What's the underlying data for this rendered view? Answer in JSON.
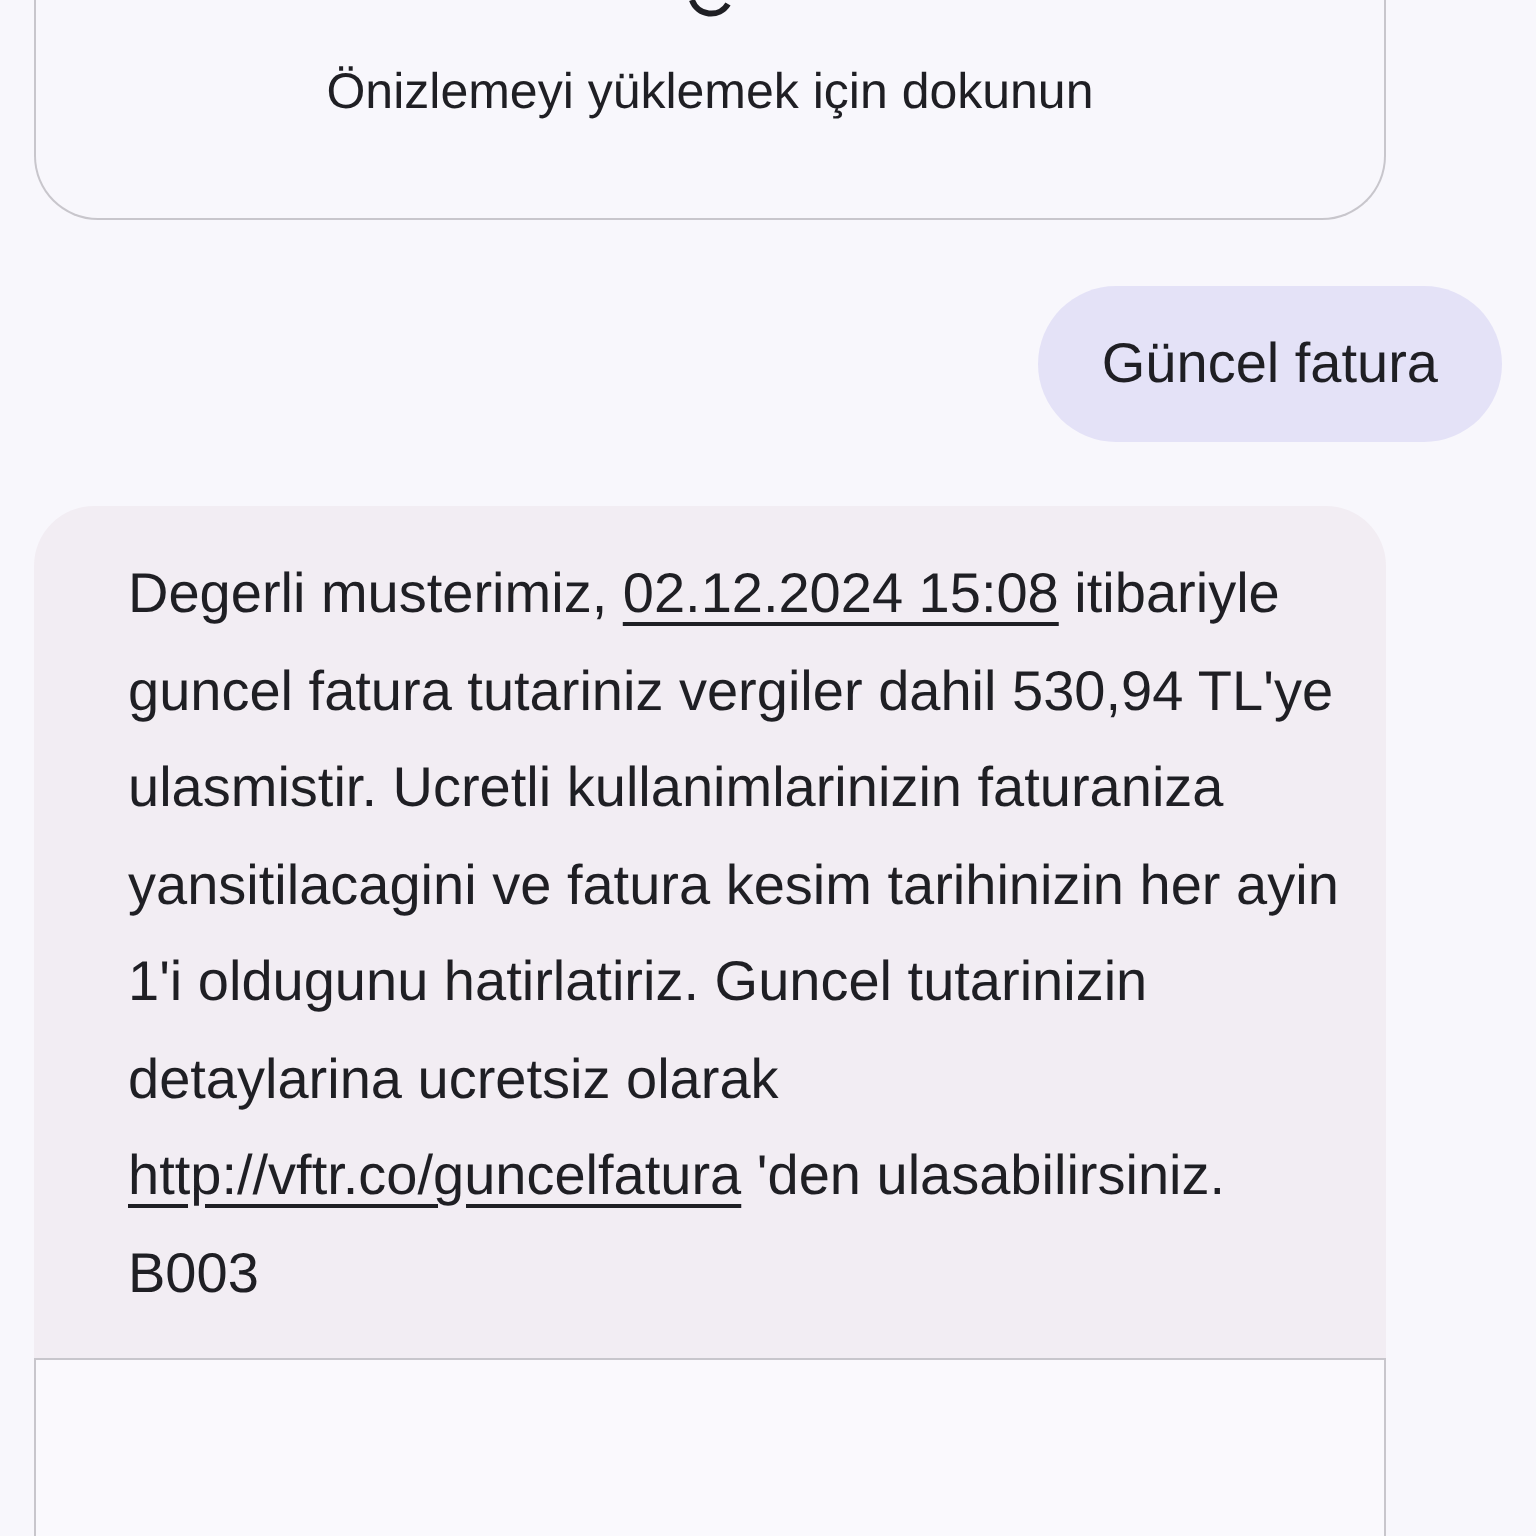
{
  "preview_card": {
    "caption": "Önizlemeyi yüklemek için dokunun"
  },
  "sent_message": {
    "text": "Güncel fatura"
  },
  "received_message": {
    "parts": [
      {
        "kind": "text",
        "text": "Degerli musterimiz, "
      },
      {
        "kind": "link",
        "text": "02.12.2024 15:08"
      },
      {
        "kind": "text",
        "text": " itibariyle guncel fatura tutariniz vergiler dahil 530,94 TL'ye ulasmistir. Ucretli kullanimlarinizin faturaniza yansitilacagini ve fatura kesim tarihinizin her ayin 1'i oldugunu hatirlatiriz. Guncel tutarinizin detaylarina ucretsiz olarak "
      },
      {
        "kind": "link",
        "text": "http://vftr.co/guncelfatura"
      },
      {
        "kind": "text",
        "text": " 'den ulasabilirsiniz. B003"
      }
    ]
  }
}
